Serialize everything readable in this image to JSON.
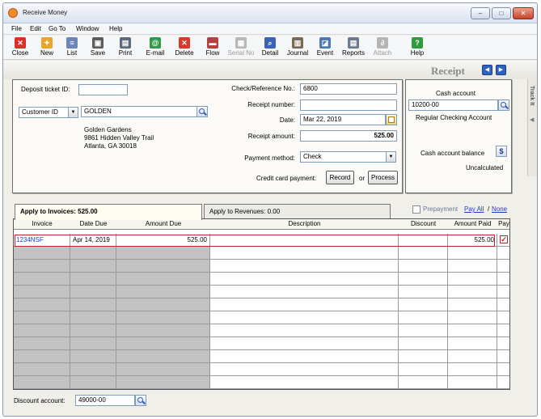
{
  "window": {
    "title": "Receive Money",
    "controls": [
      "–",
      "□",
      "✕"
    ]
  },
  "menu": [
    {
      "label": "File"
    },
    {
      "label": "Edit"
    },
    {
      "label": "Go To"
    },
    {
      "label": "Window"
    },
    {
      "label": "Help"
    }
  ],
  "toolbar": [
    {
      "label": "Close",
      "icon": "close-icon",
      "color": "#d9302a",
      "glyph": "✕",
      "enabled": true
    },
    {
      "label": "New",
      "icon": "new-icon",
      "color": "#e9a52b",
      "glyph": "✦",
      "enabled": true
    },
    {
      "label": "List",
      "icon": "list-icon",
      "color": "#6d86b8",
      "glyph": "≡",
      "enabled": true
    },
    {
      "label": "Save",
      "icon": "save-icon",
      "color": "#5c5c5c",
      "glyph": "▣",
      "enabled": true
    },
    {
      "label": "Print",
      "icon": "print-icon",
      "color": "#5b6a7c",
      "glyph": "▤",
      "enabled": true
    },
    {
      "label": "E-mail",
      "icon": "email-icon",
      "color": "#2e9a4a",
      "glyph": "@",
      "enabled": true
    },
    {
      "label": "Delete",
      "icon": "delete-icon",
      "color": "#d83a2a",
      "glyph": "✕",
      "enabled": true
    },
    {
      "label": "Flow",
      "icon": "flow-icon",
      "color": "#b24141",
      "glyph": "▬",
      "enabled": true
    },
    {
      "label": "Serial No",
      "icon": "serial-no-icon",
      "color": "#b8b8b8",
      "glyph": "▦",
      "enabled": false
    },
    {
      "label": "Detail",
      "icon": "detail-icon",
      "color": "#3a63b8",
      "glyph": "⌕",
      "enabled": true
    },
    {
      "label": "Journal",
      "icon": "journal-icon",
      "color": "#7a6a52",
      "glyph": "▥",
      "enabled": true
    },
    {
      "label": "Event",
      "icon": "event-icon",
      "color": "#4a78b8",
      "glyph": "◪",
      "enabled": true
    },
    {
      "label": "Reports",
      "icon": "reports-icon",
      "color": "#6b7a8e",
      "glyph": "▤",
      "enabled": true
    },
    {
      "label": "Attach",
      "icon": "attach-icon",
      "color": "#b5b5b5",
      "glyph": "∂",
      "enabled": false
    },
    {
      "label": "Help",
      "icon": "help-icon",
      "color": "#2f9b3c",
      "glyph": "?",
      "enabled": true
    }
  ],
  "header": {
    "title": "Receipt",
    "prev": "◀",
    "next": "▶",
    "rail_label": "Track It",
    "rail_arrow": "◀"
  },
  "customer": {
    "deposit_ticket_label": "Deposit ticket ID:",
    "deposit_ticket_value": "",
    "id_type": "Customer ID",
    "id_value": "GOLDEN",
    "address": [
      "Golden Gardens",
      "9861 Hidden Valley Trail",
      "Atlanta, GA 30018"
    ]
  },
  "receipt": {
    "check_ref_label": "Check/Reference No.:",
    "check_ref_value": "6800",
    "receipt_number_label": "Receipt number:",
    "receipt_number_value": "",
    "date_label": "Date:",
    "date_value": "Mar 22, 2019",
    "amount_label": "Receipt amount:",
    "amount_value": "525.00",
    "payment_method_label": "Payment method:",
    "payment_method_value": "Check",
    "cc_label": "Credit card payment:",
    "record_label": "Record",
    "or_label": "or",
    "process_label": "Process"
  },
  "cash": {
    "account_label": "Cash account",
    "account_value": "10200-00",
    "account_name": "Regular Checking Account",
    "balance_label": "Cash account balance",
    "balance_value": "Uncalculated"
  },
  "tabs": {
    "invoices": "Apply to Invoices: 525.00",
    "revenues": "Apply to Revenues: 0.00",
    "prepayment": "Prepayment",
    "pay_all": "Pay All",
    "slash": "/",
    "none": "None"
  },
  "grid": {
    "columns": [
      "Invoice",
      "Date Due",
      "Amount Due",
      "Description",
      "Discount",
      "Amount Paid",
      "Pay"
    ],
    "rows": [
      {
        "invoice": "1234NSF",
        "date_due": "Apr 14, 2019",
        "amount_due": "525.00",
        "description": "",
        "discount": "",
        "amount_paid": "525.00",
        "pay": "✓"
      }
    ],
    "empty_rows": 11
  },
  "footer": {
    "discount_label": "Discount account:",
    "discount_value": "49000-00"
  },
  "colors": {
    "selection_outline": "#c0242c",
    "link": "#1c3fc9",
    "gray_cell": "#c2c2c2"
  }
}
